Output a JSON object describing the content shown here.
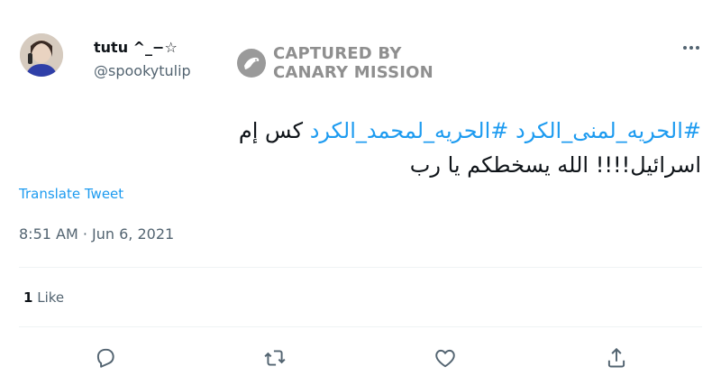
{
  "user": {
    "display_name": "tutu ^_−☆",
    "handle": "@spookytulip"
  },
  "watermark": {
    "line1": "CAPTURED BY",
    "line2": "CANARY MISSION"
  },
  "tweet": {
    "hashtag1": "#الحريه_لمنى_الكرد",
    "hashtag2": "#الحريه_لمحمد_الكرد",
    "text1": "كس إم",
    "text2": "اسرائيل!!!! الله يسخطكم يا رب",
    "translate_label": "Translate Tweet",
    "timestamp": "8:51 AM · Jun 6, 2021"
  },
  "stats": {
    "likes_count": "1",
    "likes_label": "Like"
  },
  "actions": [
    {
      "name": "reply-icon"
    },
    {
      "name": "retweet-icon"
    },
    {
      "name": "like-icon"
    },
    {
      "name": "share-icon"
    }
  ],
  "colors": {
    "link": "#1d9bf0",
    "secondary": "#536471",
    "text": "#0f1419",
    "watermark": "#8f8f8f"
  }
}
